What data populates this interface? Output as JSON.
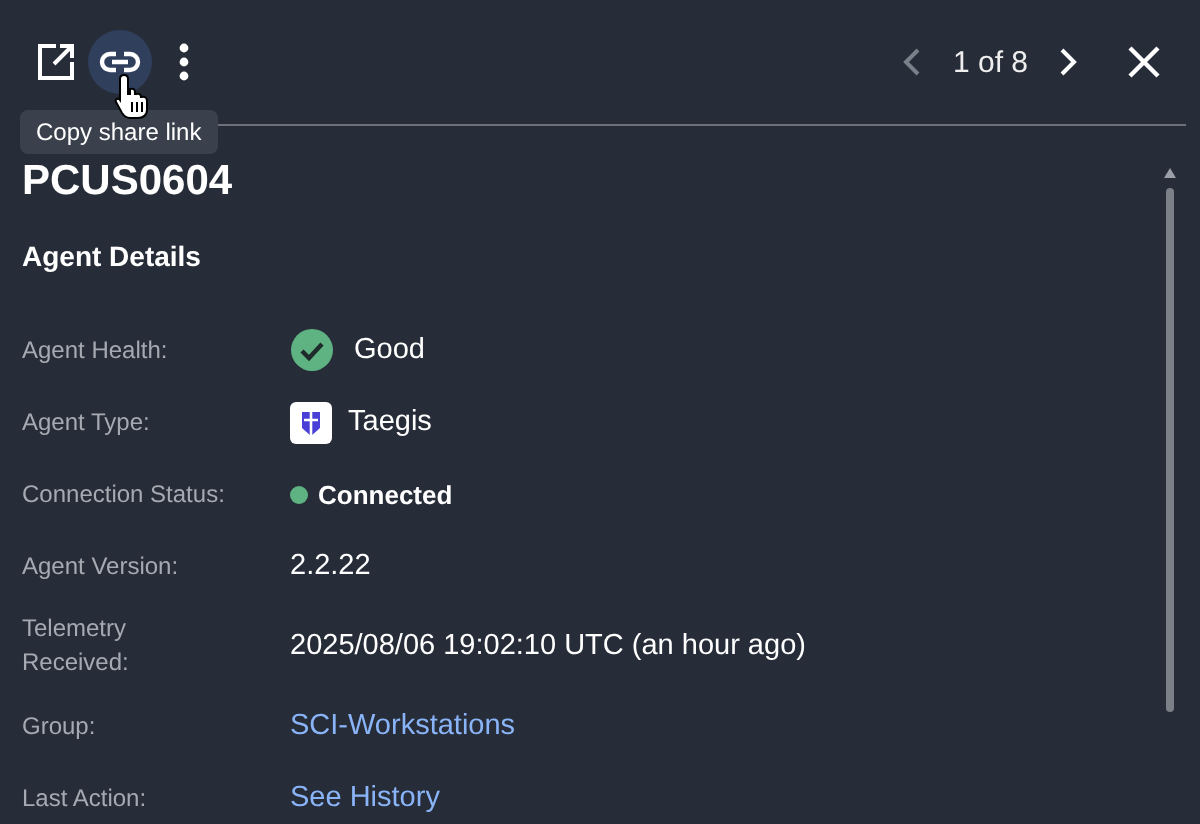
{
  "toolbar": {
    "pager": "1 of 8",
    "tooltip": "Copy share link"
  },
  "title": "PCUS0604",
  "section": "Agent Details",
  "fields": [
    {
      "label": "Agent Health:",
      "kind": "health",
      "value": "Good"
    },
    {
      "label": "Agent Type:",
      "kind": "agent",
      "value": "Taegis"
    },
    {
      "label": "Connection Status:",
      "kind": "status",
      "value": "Connected",
      "color": "#5fb382"
    },
    {
      "label": "Agent Version:",
      "kind": "text",
      "value": "2.2.22"
    },
    {
      "label": "Telemetry Received:",
      "kind": "text",
      "value": "2025/08/06 19:02:10 UTC (an hour ago)"
    },
    {
      "label": "Group:",
      "kind": "link",
      "value": "SCI-Workstations"
    },
    {
      "label": "Last Action:",
      "kind": "link",
      "value": "See History"
    }
  ]
}
